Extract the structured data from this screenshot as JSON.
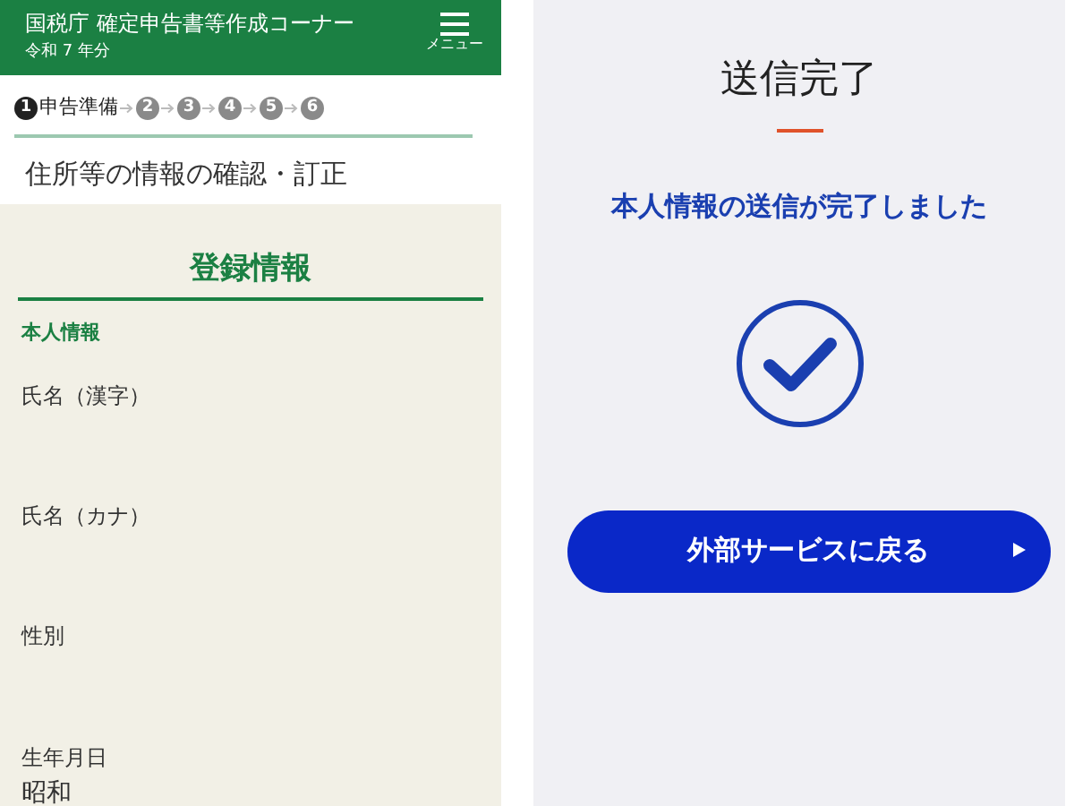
{
  "left_screen": {
    "header": {
      "title": "国税庁 確定申告書等作成コーナー",
      "subtitle": "令和 7 年分",
      "menu_label": "メニュー"
    },
    "steps": [
      {
        "number": "1",
        "label": "申告準備",
        "selected": true
      },
      {
        "number": "2",
        "selected": false
      },
      {
        "number": "3",
        "selected": false
      },
      {
        "number": "4",
        "selected": false
      },
      {
        "number": "5",
        "selected": false
      },
      {
        "number": "6",
        "selected": false
      }
    ],
    "page_title": "住所等の情報の確認・訂正",
    "section_title": "登録情報",
    "subsection_title": "本人情報",
    "fields": [
      {
        "label": "氏名（漢字）"
      },
      {
        "label": "氏名（カナ）"
      },
      {
        "label": "性別"
      },
      {
        "label": "生年月日",
        "value": "昭和"
      }
    ]
  },
  "right_screen": {
    "title": "送信完了",
    "message": "本人情報の送信が完了しました",
    "button": {
      "label": "外部サービスに戻る"
    }
  }
}
